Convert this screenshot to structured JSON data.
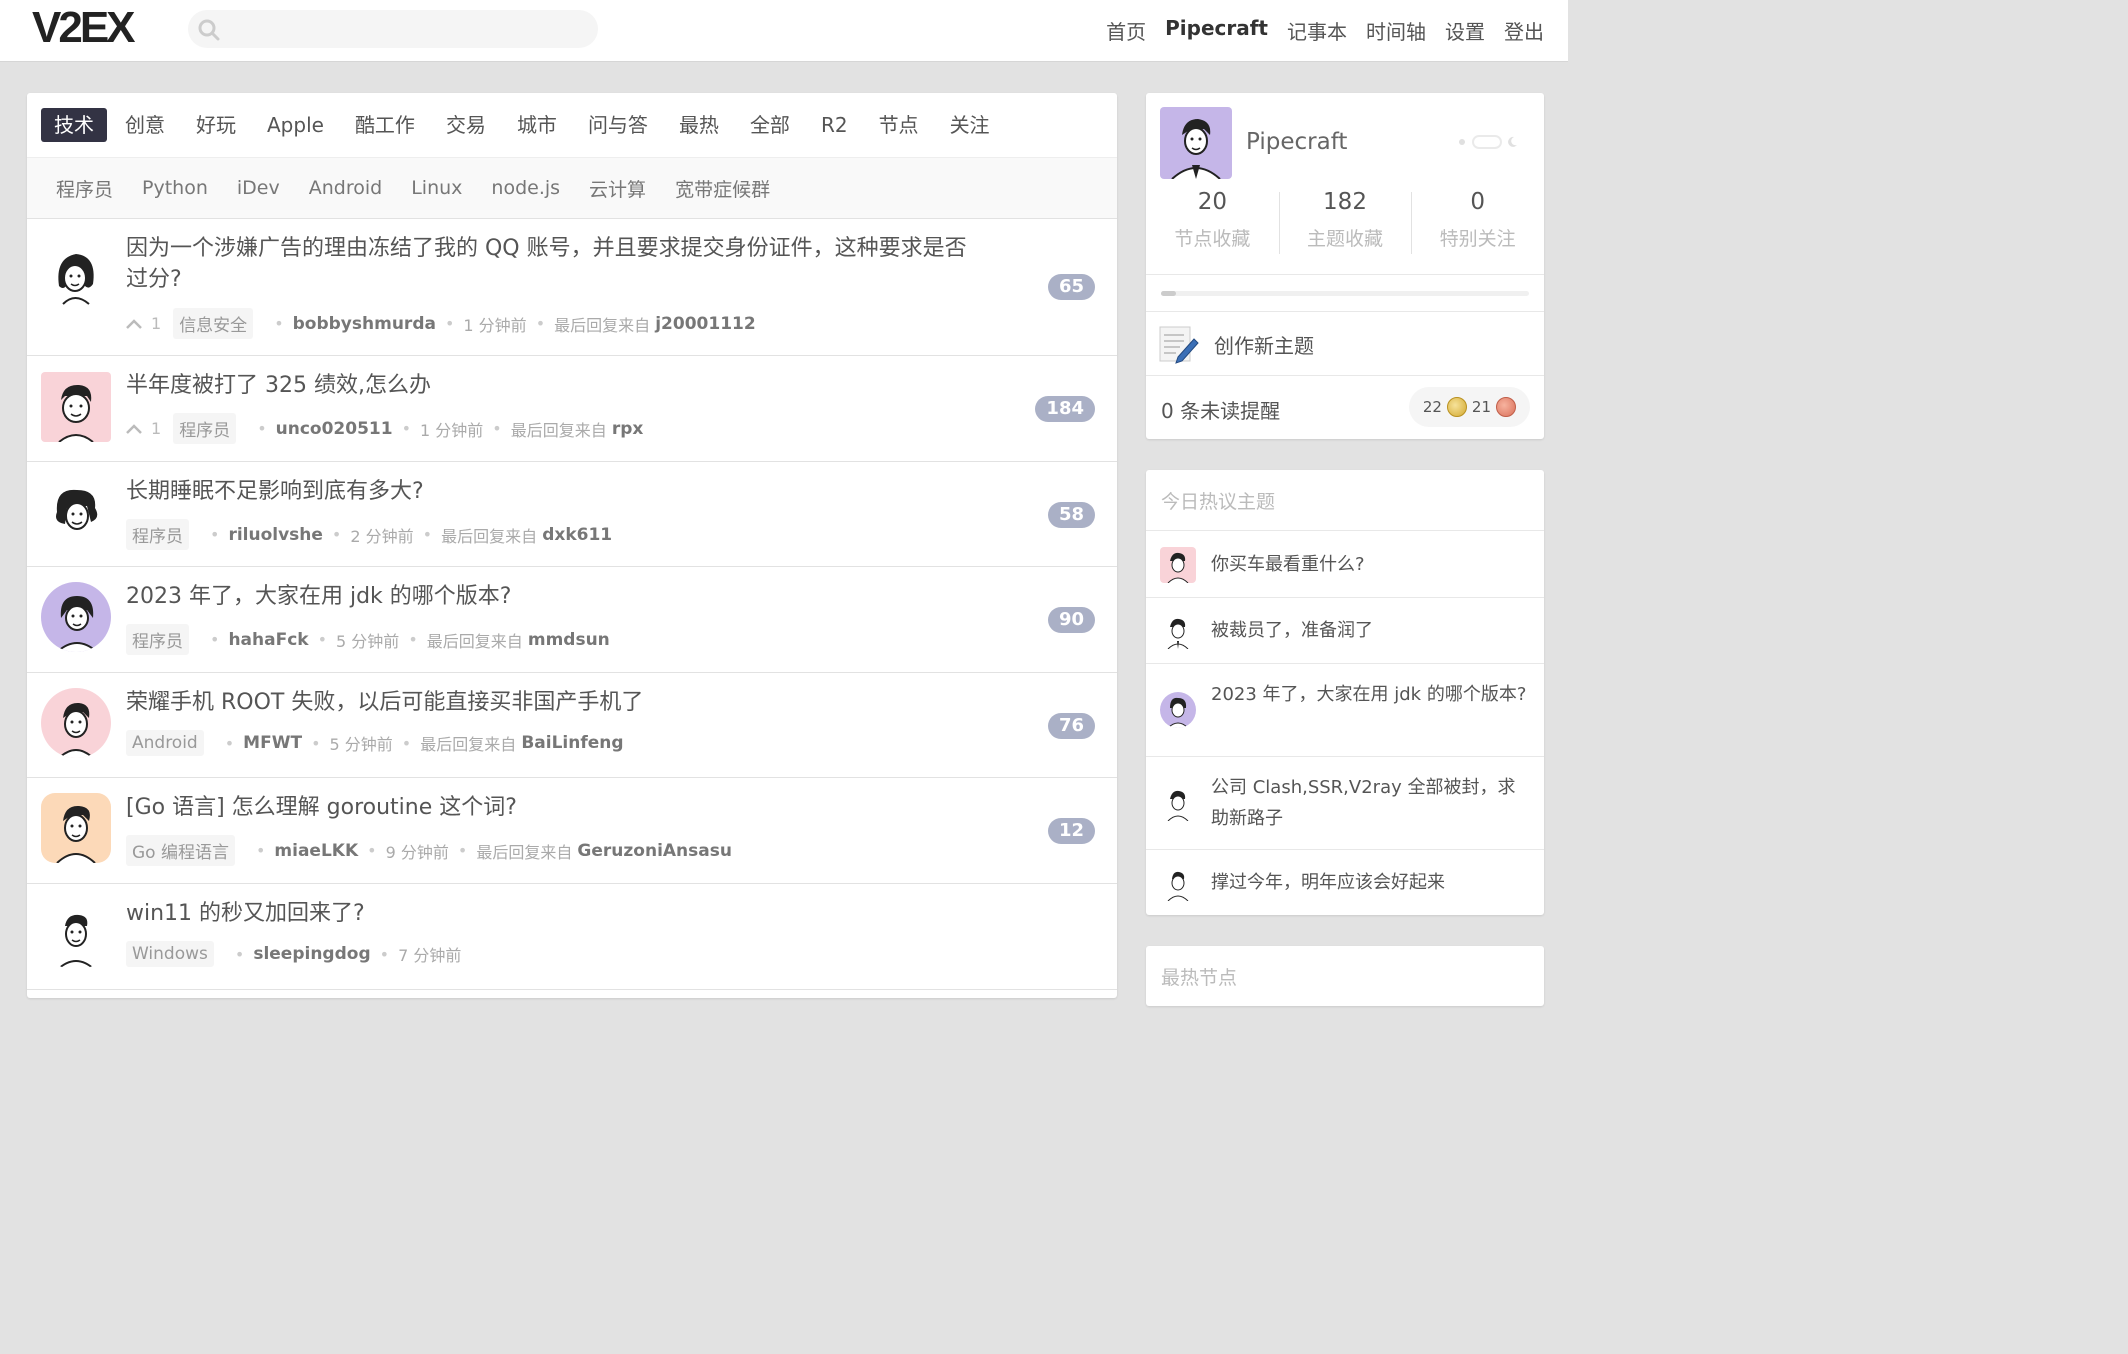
{
  "header": {
    "logo": "V2EX",
    "search_placeholder": "",
    "nav": [
      "首页",
      "Pipecraft",
      "记事本",
      "时间轴",
      "设置",
      "登出"
    ]
  },
  "tabs": [
    "技术",
    "创意",
    "好玩",
    "Apple",
    "酷工作",
    "交易",
    "城市",
    "问与答",
    "最热",
    "全部",
    "R2",
    "节点",
    "关注"
  ],
  "active_tab": "技术",
  "subtabs": [
    "程序员",
    "Python",
    "iDev",
    "Android",
    "Linux",
    "node.js",
    "云计算",
    "宽带症候群"
  ],
  "topics": [
    {
      "title": "因为一个涉嫌广告的理由冻结了我的 QQ 账号，并且要求提交身份证件，这种要求是否过分?",
      "votes": "1",
      "node": "信息安全",
      "author": "bobbyshmurda",
      "time": "1 分钟前",
      "last_reply_label": "最后回复来自",
      "last_reply": "j20001112",
      "replies": "65"
    },
    {
      "title": "半年度被打了 325 绩效,怎么办",
      "votes": "1",
      "node": "程序员",
      "author": "unco020511",
      "time": "1 分钟前",
      "last_reply_label": "最后回复来自",
      "last_reply": "rpx",
      "replies": "184"
    },
    {
      "title": "长期睡眠不足影响到底有多大?",
      "node": "程序员",
      "author": "riluolvshe",
      "time": "2 分钟前",
      "last_reply_label": "最后回复来自",
      "last_reply": "dxk611",
      "replies": "58"
    },
    {
      "title": "2023 年了，大家在用 jdk 的哪个版本?",
      "node": "程序员",
      "author": "hahaFck",
      "time": "5 分钟前",
      "last_reply_label": "最后回复来自",
      "last_reply": "mmdsun",
      "replies": "90"
    },
    {
      "title": "荣耀手机 ROOT 失败，以后可能直接买非国产手机了",
      "node": "Android",
      "author": "MFWT",
      "time": "5 分钟前",
      "last_reply_label": "最后回复来自",
      "last_reply": "BaiLinfeng",
      "replies": "76"
    },
    {
      "title": "[Go 语言] 怎么理解 goroutine 这个词?",
      "node": "Go 编程语言",
      "author": "miaeLKK",
      "time": "9 分钟前",
      "last_reply_label": "最后回复来自",
      "last_reply": "GeruzoniAnsasu",
      "replies": "12"
    },
    {
      "title": "win11 的秒又加回来了?",
      "node": "Windows",
      "author": "sleepingdog",
      "time": "7 分钟前"
    }
  ],
  "profile": {
    "username": "Pipecraft",
    "stats": [
      {
        "num": "20",
        "label": "节点收藏"
      },
      {
        "num": "182",
        "label": "主题收藏"
      },
      {
        "num": "0",
        "label": "特别关注"
      }
    ],
    "progress": 0.04,
    "create_topic": "创作新主题",
    "notifications": "0 条未读提醒",
    "balance": {
      "silver": "22",
      "bronze": "21"
    }
  },
  "hot_today": {
    "title": "今日热议主题",
    "items": [
      "你买车最看重什么?",
      "被裁员了，准备润了",
      "2023 年了，大家在用 jdk 的哪个版本?",
      "公司 Clash,SSR,V2ray 全部被封，求助新路子",
      "撑过今年，明年应该会好起来"
    ]
  },
  "hot_nodes": {
    "title": "最热节点"
  },
  "colors": {
    "accent": "#333344",
    "count_badge": "#aab0c6",
    "background": "#e2e2e2"
  }
}
